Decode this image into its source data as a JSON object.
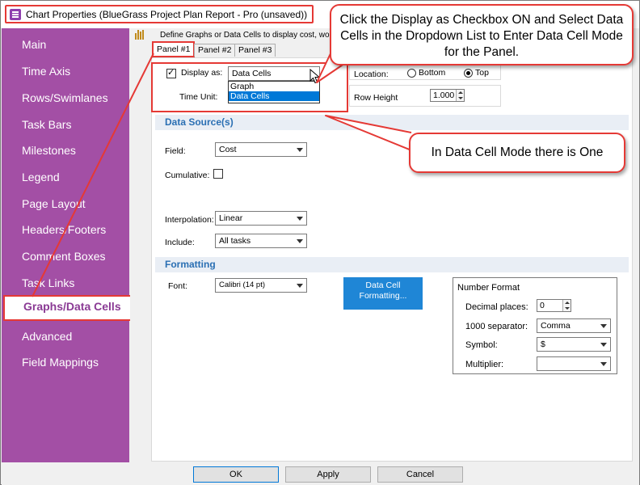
{
  "window": {
    "title": "Chart Properties (BlueGrass Project Plan Report - Pro (unsaved))"
  },
  "sidebar": {
    "items": [
      {
        "label": "Main"
      },
      {
        "label": "Time Axis"
      },
      {
        "label": "Rows/Swimlanes"
      },
      {
        "label": "Task Bars"
      },
      {
        "label": "Milestones"
      },
      {
        "label": "Legend"
      },
      {
        "label": "Page Layout"
      },
      {
        "label": "Headers/Footers"
      },
      {
        "label": "Comment Boxes"
      },
      {
        "label": "Task Links"
      },
      {
        "label": "Graphs/Data Cells"
      },
      {
        "label": "Advanced"
      },
      {
        "label": "Field Mappings"
      }
    ],
    "active": "Graphs/Data Cells"
  },
  "main": {
    "description": "Define Graphs or Data Cells to display cost, wo",
    "tabs": [
      "Panel #1",
      "Panel #2",
      "Panel #3"
    ],
    "display_as": {
      "label": "Display as:",
      "checked": true,
      "value": "Data Cells",
      "options": [
        "Graph",
        "Data Cells"
      ],
      "selected_option": "Data Cells"
    },
    "time_unit_label": "Time Unit:",
    "location": {
      "label": "Location:",
      "options": [
        "Bottom",
        "Top"
      ],
      "selected": "Top"
    },
    "row_height": {
      "label": "Row Height",
      "value": "1.000"
    },
    "data_source": {
      "header": "Data Source(s)",
      "field_label": "Field:",
      "field_value": "Cost",
      "cumulative_label": "Cumulative:",
      "cumulative_checked": false,
      "interpolation_label": "Interpolation:",
      "interpolation_value": "Linear",
      "include_label": "Include:",
      "include_value": "All tasks"
    },
    "formatting": {
      "header": "Formatting",
      "font_label": "Font:",
      "font_value": "Calibri (14 pt)",
      "data_cell_button": "Data Cell Formatting...",
      "number_format": {
        "title": "Number Format",
        "decimal_label": "Decimal places:",
        "decimal_value": "0",
        "separator_label": "1000 separator:",
        "separator_value": "Comma",
        "symbol_label": "Symbol:",
        "symbol_value": "$",
        "multiplier_label": "Multiplier:",
        "multiplier_value": ""
      }
    }
  },
  "buttons": {
    "ok": "OK",
    "apply": "Apply",
    "cancel": "Cancel"
  },
  "callouts": {
    "top": "Click the Display as Checkbox ON and Select Data Cells in the Dropdown List to Enter Data Cell Mode for the Panel.",
    "middle": "In Data Cell Mode there is One"
  },
  "colors": {
    "sidebar": "#a34fa5",
    "annotation_red": "#e53935",
    "section_header_text": "#2a6fb3",
    "primary_button": "#1f86d6",
    "selection": "#0078d7"
  }
}
